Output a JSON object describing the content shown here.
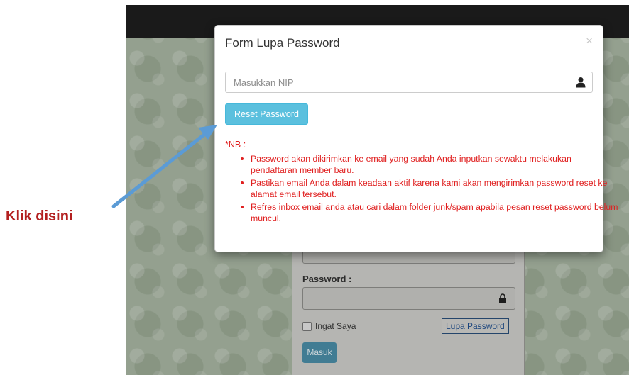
{
  "modal": {
    "title": "Form Lupa Password",
    "close_symbol": "×",
    "nip_placeholder": "Masukkan NIP",
    "reset_button": "Reset Password",
    "nb_label": "*NB :",
    "notes": [
      "Password akan dikirimkan ke email yang sudah Anda inputkan sewaktu melakukan pendaftaran member baru.",
      "Pastikan email Anda dalam keadaan aktif karena kami akan mengirimkan password reset ke alamat email tersebut.",
      "Refres inbox email anda atau cari dalam folder junk/spam apabila pesan reset password belum muncul."
    ]
  },
  "login": {
    "password_label": "Password :",
    "remember_label": "Ingat Saya",
    "forgot_link": "Lupa Password",
    "submit_button": "Masuk"
  },
  "annotation": {
    "label": "Klik disini",
    "arrow_color": "#5b9bd5",
    "label_color": "#b32020"
  },
  "icons": {
    "nip_icon": "user-icon",
    "password_icon": "lock-icon"
  }
}
